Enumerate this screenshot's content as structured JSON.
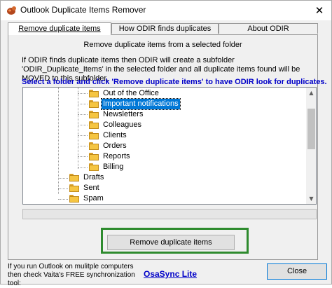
{
  "window": {
    "title": "Outlook Duplicate Items Remover",
    "close_glyph": "✕"
  },
  "tabs": [
    {
      "label": "Remove duplicate items",
      "active": true
    },
    {
      "label": "How ODIR finds duplicates",
      "active": false
    },
    {
      "label": "About ODIR",
      "active": false
    }
  ],
  "panel": {
    "subtitle": "Remove duplicate items from a selected folder",
    "info": "If ODIR finds duplicate items then ODIR will create a subfolder 'ODIR_Duplicate_Items' in the selected folder and all duplicate items found will be MOVED to this subfolder.",
    "instruction": "Select a folder and click 'Remove duplicate items' to have ODIR look for duplicates."
  },
  "tree": {
    "items": [
      {
        "label": "Out of the Office",
        "selected": false
      },
      {
        "label": "Important notifications",
        "selected": true
      },
      {
        "label": "Newsletters",
        "selected": false
      },
      {
        "label": "Colleagues",
        "selected": false
      },
      {
        "label": "Clients",
        "selected": false
      },
      {
        "label": "Orders",
        "selected": false
      },
      {
        "label": "Reports",
        "selected": false
      },
      {
        "label": "Billing",
        "selected": false
      },
      {
        "label": "Drafts",
        "selected": false
      },
      {
        "label": "Sent",
        "selected": false
      },
      {
        "label": "Spam",
        "selected": false
      }
    ],
    "icon": "folder-icon"
  },
  "buttons": {
    "remove": "Remove duplicate items",
    "close": "Close"
  },
  "footer": {
    "text": "If you run Outlook on mulitple computers then check Vaita's FREE synchronization tool:",
    "link": "OsaSync Lite"
  },
  "colors": {
    "instruction": "#0000c8",
    "selection": "#0078d7",
    "highlight_box": "#2e8b2e",
    "folder": "#f5c542"
  }
}
